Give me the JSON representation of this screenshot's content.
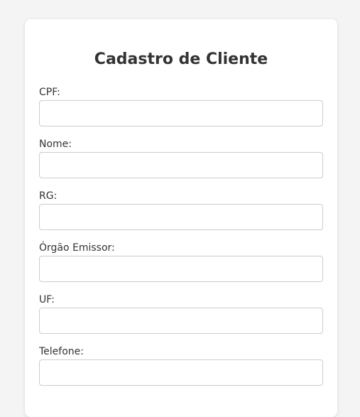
{
  "form": {
    "title": "Cadastro de Cliente",
    "fields": [
      {
        "label": "CPF:",
        "value": "",
        "placeholder": ""
      },
      {
        "label": "Nome:",
        "value": "",
        "placeholder": ""
      },
      {
        "label": "RG:",
        "value": "",
        "placeholder": ""
      },
      {
        "label": "Órgão Emissor:",
        "value": "",
        "placeholder": ""
      },
      {
        "label": "UF:",
        "value": "",
        "placeholder": ""
      },
      {
        "label": "Telefone:",
        "value": "",
        "placeholder": ""
      }
    ]
  },
  "colors": {
    "page_background": "#f4f4f4",
    "card_background": "#ffffff",
    "text": "#333333",
    "input_border": "#cccccc"
  }
}
